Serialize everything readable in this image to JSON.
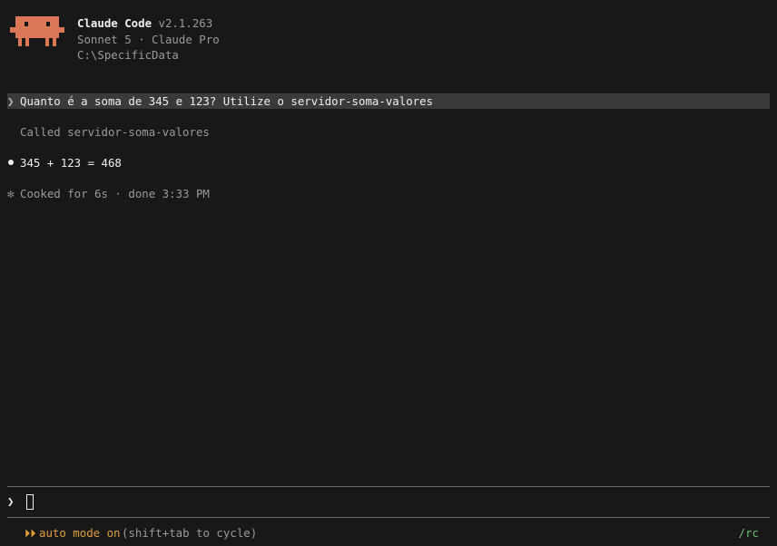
{
  "header": {
    "app_name": "Claude Code",
    "version": "v2.1.263",
    "model_plan": "Sonnet 5 · Claude Pro",
    "cwd": "C:\\SpecificData",
    "logo_color": "#d97757"
  },
  "transcript": {
    "prompt_symbol": "❯",
    "user_prompt": "Quanto é a soma de 345 e 123? Utilize o servidor-soma-valores",
    "tool_call": "Called servidor-soma-valores",
    "answer": "345 + 123 = 468",
    "status_symbol": "✻",
    "status": "Cooked for 6s · done 3:33 PM"
  },
  "input": {
    "chevron": "❯",
    "value": ""
  },
  "footer": {
    "mode_icon": "⏵⏵",
    "mode_label": "auto mode on",
    "mode_hint": "(shift+tab to cycle)",
    "remote_link": "/rc",
    "mode_color": "#e0a03a",
    "link_color": "#6cc070"
  }
}
